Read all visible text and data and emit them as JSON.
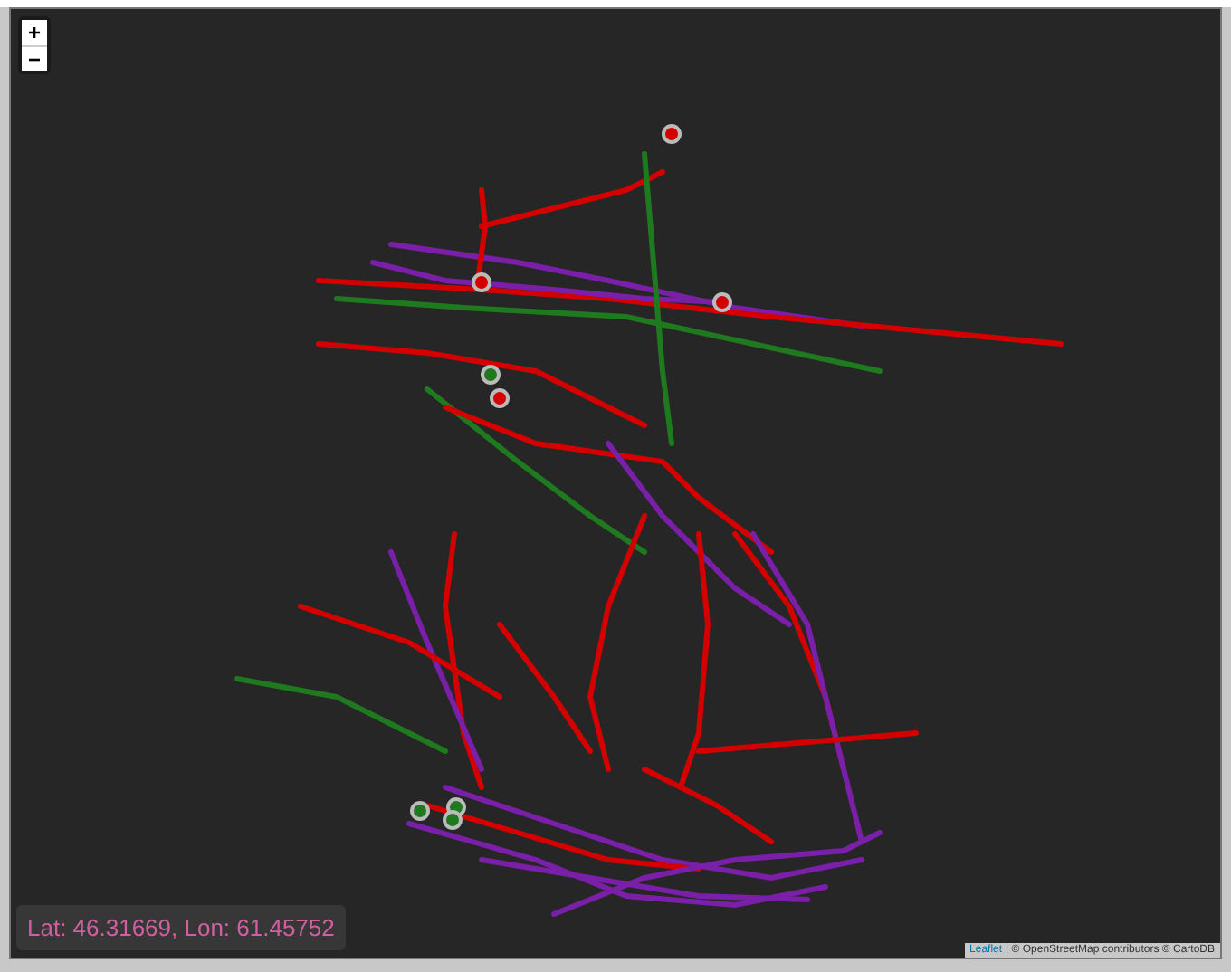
{
  "zoom_controls": [
    {
      "label": "+"
    },
    {
      "label": "−"
    }
  ],
  "coordinates": "Lat: 46.31669, Lon: 61.45752",
  "attribution": {
    "link": "Leaflet",
    "text": "| © OpenStreetMap contributors © CartoDB"
  }
}
